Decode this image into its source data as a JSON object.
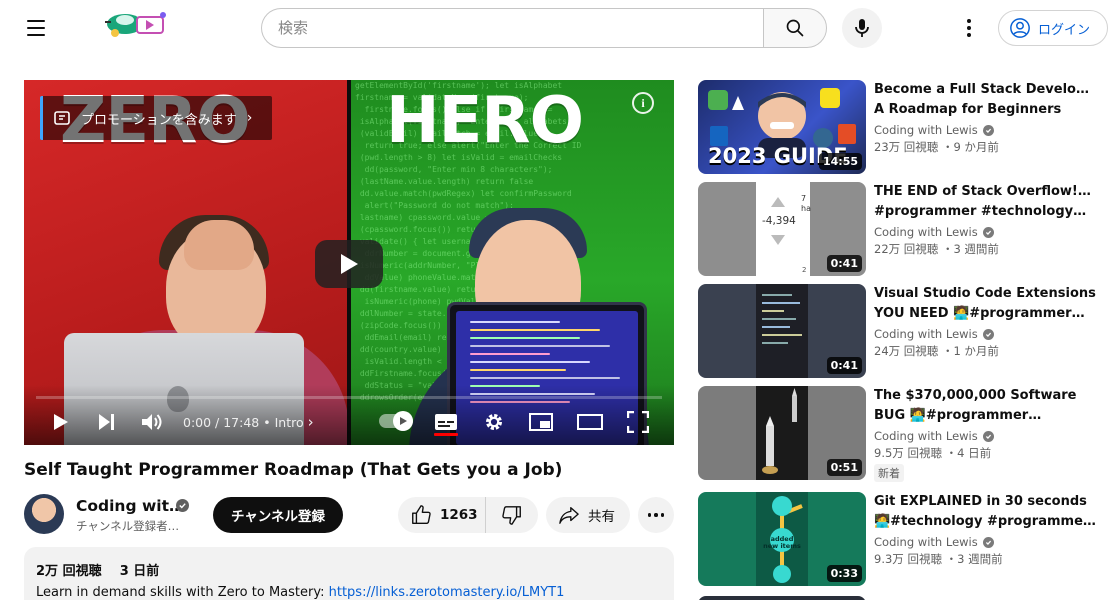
{
  "header": {
    "search_placeholder": "検索",
    "login_label": "ログイン"
  },
  "player": {
    "overlay_left_word": "ZERO",
    "overlay_right_word": "HERO",
    "promo_label": "プロモーションを含みます",
    "info_label": "i",
    "time": "0:00 / 17:48",
    "chapter": "Intro",
    "progress_fraction": 0
  },
  "video": {
    "title": "Self Taught Programmer Roadmap (That Gets you a Job)",
    "channel_name": "Coding wit…",
    "subscribers": "チャンネル登録者…",
    "subscribe_label": "チャンネル登録",
    "likes": "1263",
    "share_label": "共有"
  },
  "description": {
    "views": "2万 回視聴",
    "date": "3 日前",
    "text_prefix": "Learn in demand skills with Zero to Mastery: ",
    "link": "https://links.zerotomastery.io/LMYT1"
  },
  "recommendations": [
    {
      "title_line1": "Become a Full Stack Developer:",
      "title_line2": "A Roadmap for Beginners",
      "channel": "Coding with Lewis",
      "stats": "23万 回視聴 ・9 か月前",
      "duration": "14:55",
      "thumb_text": "2023 GUIDE",
      "badge": ""
    },
    {
      "title_line1": "THE END of Stack Overflow!? 🧑‍💻",
      "title_line2": "#programmer #technology…",
      "channel": "Coding with Lewis",
      "stats": "22万 回視聴 ・3 週間前",
      "duration": "0:41",
      "thumb_text": "-4,394",
      "thumb_text_small": "7",
      "thumb_text_small2": "ha",
      "thumb_text_small3": "2",
      "badge": ""
    },
    {
      "title_line1": "Visual Studio Code Extensions",
      "title_line2": "YOU NEED 🧑‍💻#programmer…",
      "channel": "Coding with Lewis",
      "stats": "24万 回視聴 ・1 か月前",
      "duration": "0:41",
      "badge": ""
    },
    {
      "title_line1": "The $370,000,000 Software",
      "title_line2": "BUG 🧑‍💻#programmer…",
      "channel": "Coding with Lewis",
      "stats": "9.5万 回視聴 ・4 日前",
      "duration": "0:51",
      "badge": "新着"
    },
    {
      "title_line1": "Git EXPLAINED in 30 seconds",
      "title_line2": "🧑‍💻#technology #programmer…",
      "channel": "Coding with Lewis",
      "stats": "9.3万 回視聴 ・3 週間前",
      "duration": "0:33",
      "thumb_text": "added new items",
      "badge": ""
    }
  ],
  "colors": {
    "accent_blue": "#065fd4",
    "progress_red": "#ff0000",
    "left_panel_red": "#d62828",
    "right_panel_green": "#29a829"
  }
}
